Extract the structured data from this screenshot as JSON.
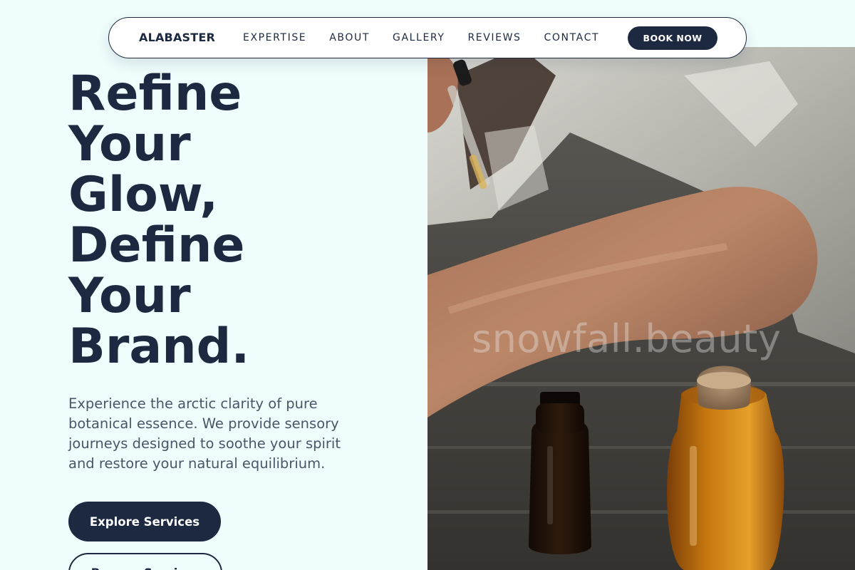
{
  "nav": {
    "brand": "ALABASTER",
    "links": [
      "EXPERTISE",
      "ABOUT",
      "GALLERY",
      "REVIEWS",
      "CONTACT"
    ],
    "cta": "BOOK NOW"
  },
  "hero": {
    "headline_lines": [
      "Refine",
      "Your",
      "Glow,",
      "Define",
      "Your",
      "Brand."
    ],
    "lede": "Experience the arctic clarity of pure botanical essence. We provide sensory journeys designed to soothe your spirit and restore your natural equilibrium.",
    "primary_button": "Explore Services",
    "secondary_button": "Browse Services",
    "image_watermark": "snowfall.beauty"
  },
  "colors": {
    "background": "#effdfc",
    "navy": "#1c2940",
    "body_text": "#4a5568"
  }
}
